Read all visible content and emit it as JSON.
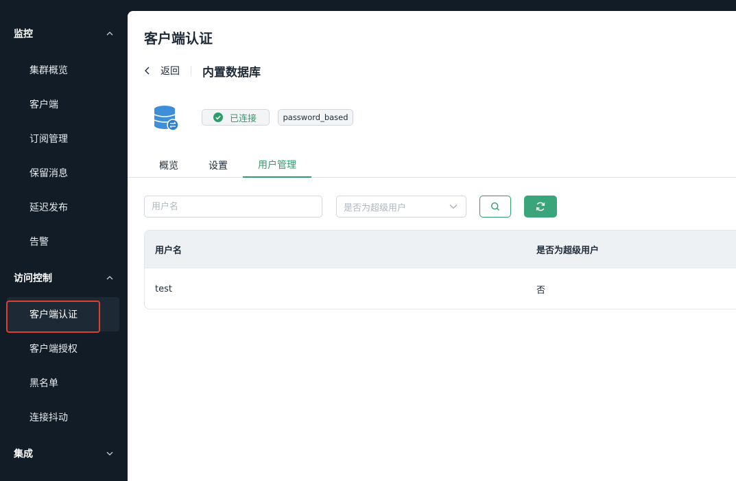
{
  "sidebar": {
    "groups": [
      {
        "label": "监控",
        "expanded": true
      },
      {
        "label": "访问控制",
        "expanded": true
      },
      {
        "label": "集成",
        "expanded": false
      }
    ],
    "monitor_items": [
      "集群概览",
      "客户端",
      "订阅管理",
      "保留消息",
      "延迟发布",
      "告警"
    ],
    "access_items": [
      "客户端认证",
      "客户端授权",
      "黑名单",
      "连接抖动"
    ],
    "active_item": "客户端认证"
  },
  "page": {
    "title": "客户端认证",
    "back_label": "返回",
    "subtitle": "内置数据库",
    "status": "已连接",
    "mechanism": "password_based"
  },
  "tabs": [
    "概览",
    "设置",
    "用户管理"
  ],
  "active_tab": "用户管理",
  "filters": {
    "username_placeholder": "用户名",
    "superuser_placeholder": "是否为超级用户"
  },
  "table": {
    "columns": [
      "用户名",
      "是否为超级用户"
    ],
    "rows": [
      {
        "username": "test",
        "is_superuser": "否"
      }
    ]
  },
  "colors": {
    "sidebar_bg": "#111c26",
    "accent": "#2f9d6b",
    "highlight": "#e0412b"
  }
}
